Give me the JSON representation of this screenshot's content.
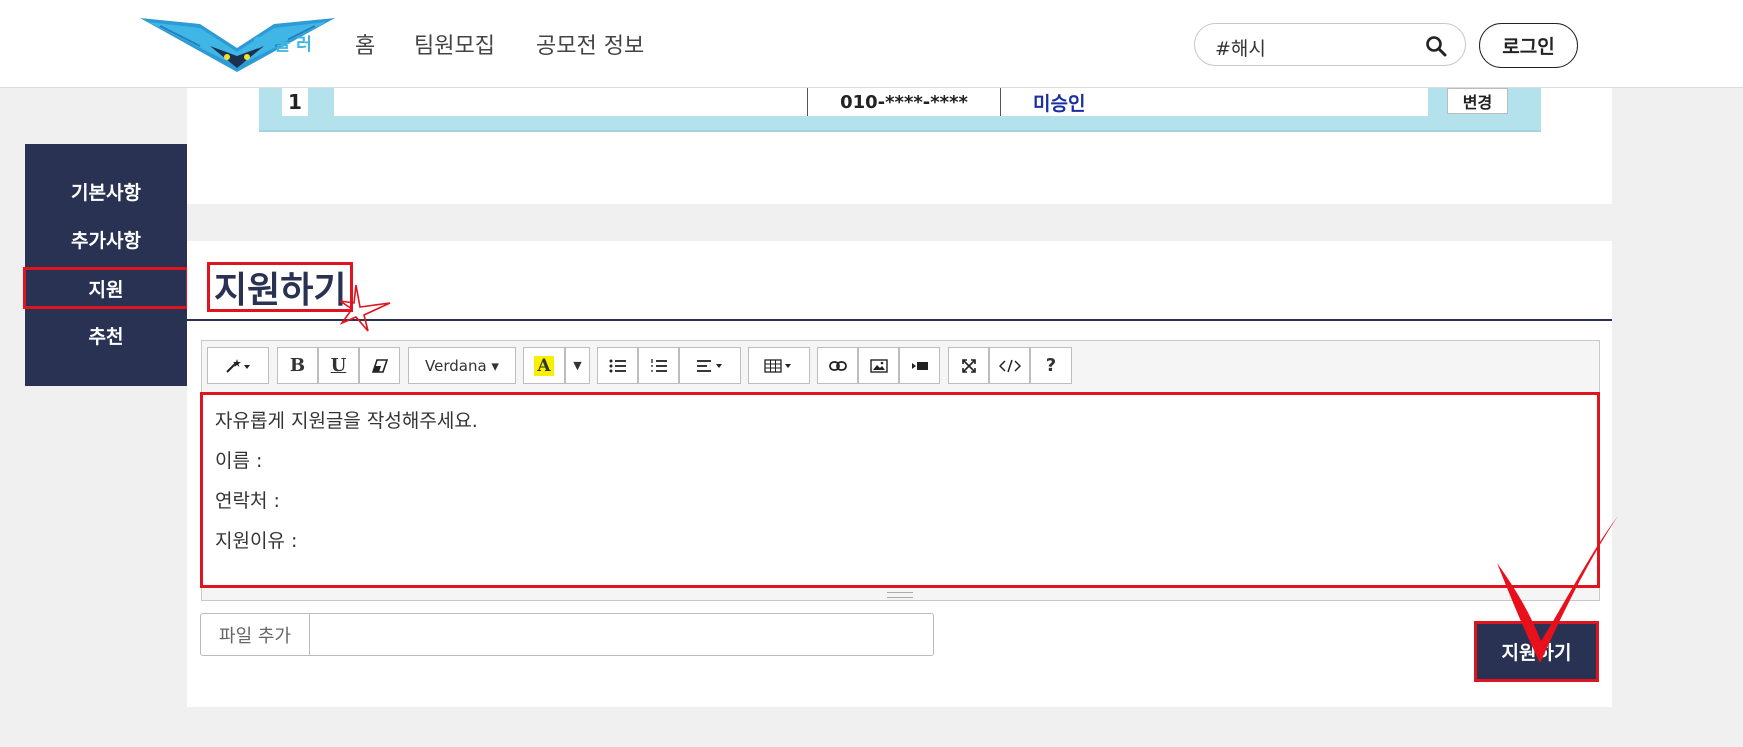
{
  "brand": {
    "name": "아울러"
  },
  "nav": {
    "items": [
      "홈",
      "팀원모집",
      "공모전 정보"
    ]
  },
  "search": {
    "value": "#해시"
  },
  "auth": {
    "login_label": "로그인"
  },
  "applicant_table": {
    "row": {
      "number": "1",
      "name": "",
      "phone": "010-****-****",
      "status": "미승인",
      "action": "변경"
    }
  },
  "sidebar": {
    "items": [
      "기본사항",
      "추가사항",
      "지원",
      "추천"
    ],
    "active": "지원"
  },
  "apply": {
    "title": "지원하기",
    "toolbar": {
      "font": "Verdana",
      "buttons": [
        "magic-wand-icon",
        "bold-icon",
        "underline-icon",
        "eraser-icon",
        "font-select",
        "text-color-icon",
        "color-dropdown-icon",
        "unordered-list-icon",
        "ordered-list-icon",
        "align-icon",
        "table-icon",
        "link-icon",
        "image-icon",
        "video-icon",
        "fullscreen-icon",
        "code-view-icon",
        "help-icon"
      ]
    },
    "editor_lines": [
      "자유롭게 지원글을 작성해주세요.",
      "이름 :",
      "연락처 :",
      "지원이유 :"
    ],
    "file_button_label": "파일 추가",
    "submit_label": "지원하기"
  },
  "colors": {
    "navy": "#2a3254",
    "highlight_red": "#e0141e",
    "table_bg": "#b3e2ec",
    "logo_blue": "#3fb6e6"
  }
}
